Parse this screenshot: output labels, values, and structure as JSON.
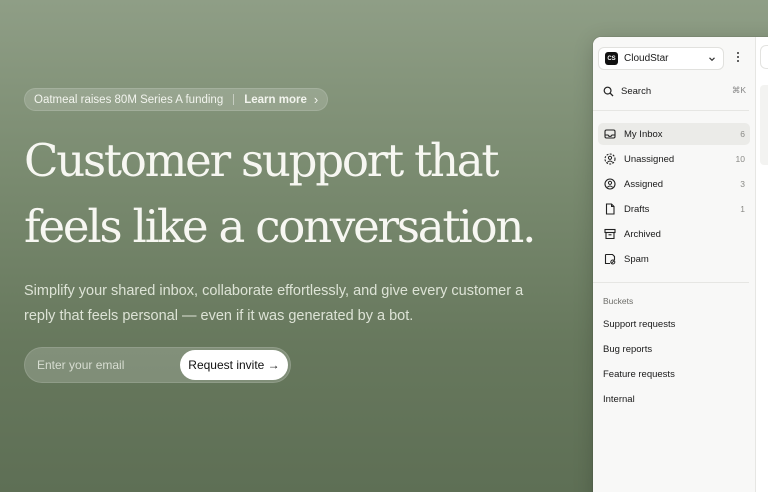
{
  "hero": {
    "announcement": {
      "text": "Oatmeal raises 80M Series A funding",
      "link": "Learn more",
      "chevron": "›"
    },
    "headline_line1": "Customer support that",
    "headline_line2": "feels like a conversation.",
    "subtitle_line1": "Simplify your shared inbox, collaborate effortlessly, and give every customer a",
    "subtitle_line2": "reply that feels personal — even if it was generated by a bot.",
    "email_placeholder": "Enter your email",
    "cta_label": "Request invite →"
  },
  "app": {
    "workspace": {
      "logo_text": "CS",
      "name": "CloudStar"
    },
    "search": {
      "label": "Search",
      "shortcut": "⌘K"
    },
    "nav": [
      {
        "label": "My Inbox",
        "count": "6",
        "icon": "inbox-icon",
        "active": true
      },
      {
        "label": "Unassigned",
        "count": "10",
        "icon": "unassigned-user-icon"
      },
      {
        "label": "Assigned",
        "count": "3",
        "icon": "assigned-user-icon"
      },
      {
        "label": "Drafts",
        "count": "1",
        "icon": "draft-document-icon"
      },
      {
        "label": "Archived",
        "count": "",
        "icon": "archive-box-icon"
      },
      {
        "label": "Spam",
        "count": "",
        "icon": "spam-icon"
      }
    ],
    "buckets_label": "Buckets",
    "buckets": [
      "Support requests",
      "Bug reports",
      "Feature requests",
      "Internal"
    ]
  },
  "colors": {
    "background_top": "#8f9e86",
    "background_bottom": "#5e6f55",
    "headline": "#f7f7f2",
    "cta_background": "#ffffff",
    "sidebar_background": "#f8f8f7",
    "active_item": "#ebebe8"
  }
}
